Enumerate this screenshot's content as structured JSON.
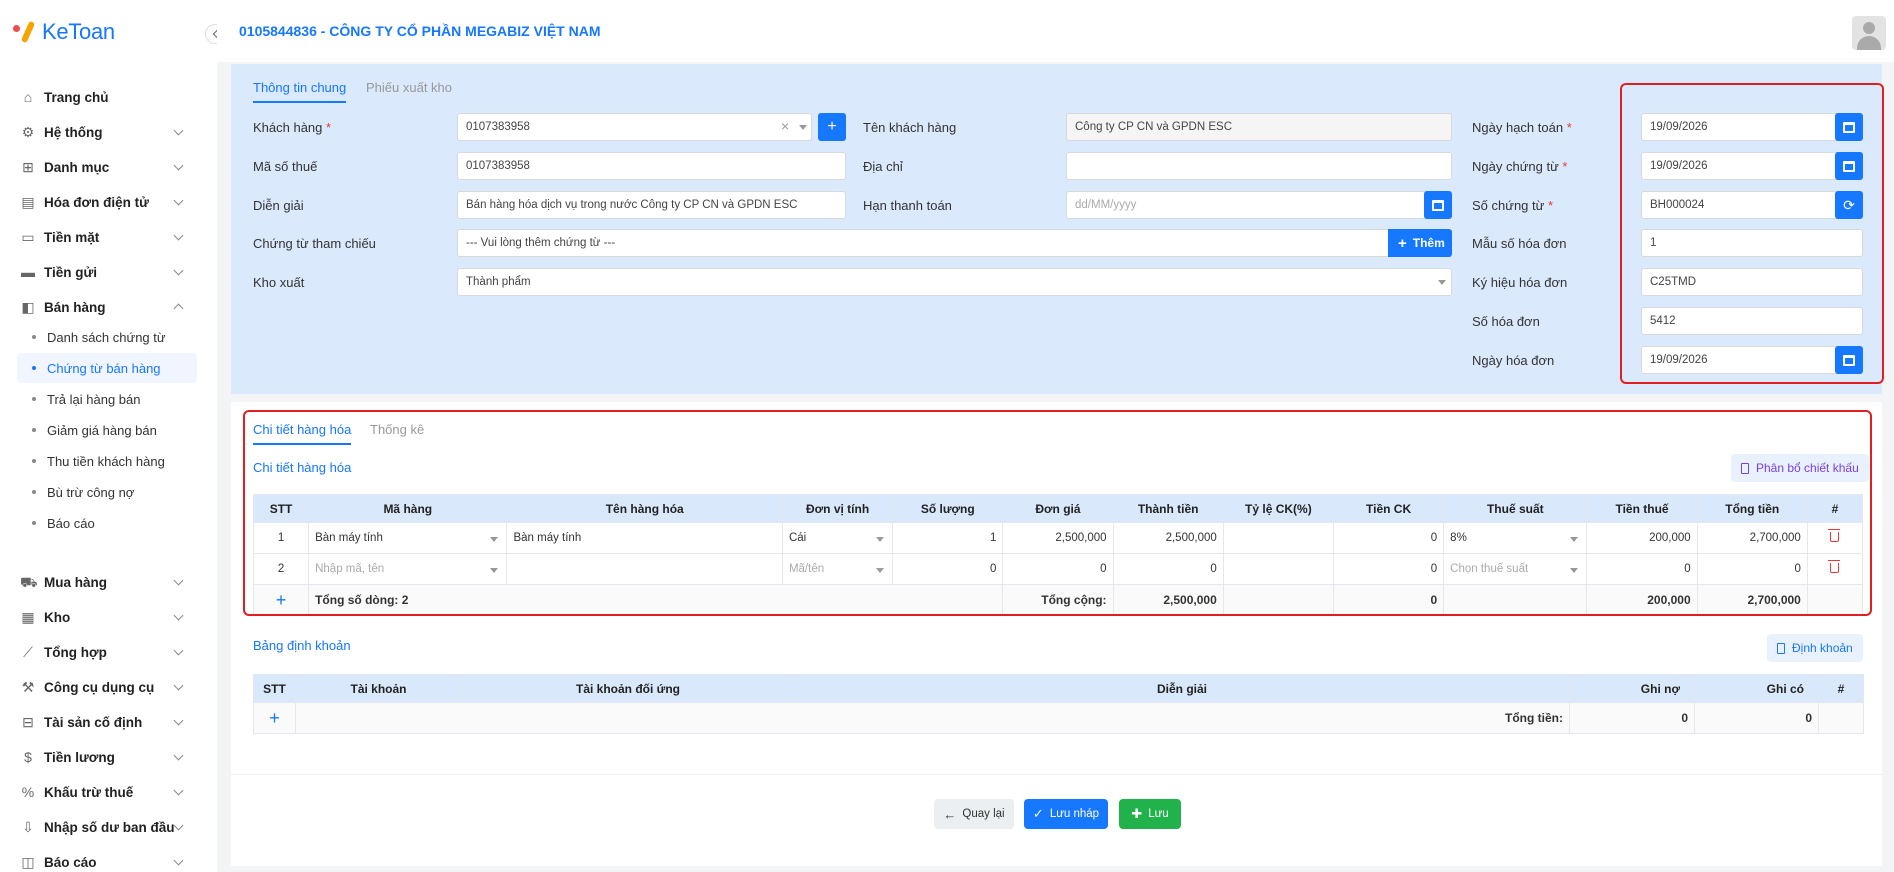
{
  "app": {
    "brand": "KeToan",
    "company": "0105844836 - CÔNG TY CỔ PHẦN MEGABIZ VIỆT NAM"
  },
  "sidebar": {
    "items": [
      {
        "label": "Trang chủ",
        "icon": "home-icon"
      },
      {
        "label": "Hệ thống",
        "icon": "gear-icon"
      },
      {
        "label": "Danh mục",
        "icon": "grid-icon"
      },
      {
        "label": "Hóa đơn điện tử",
        "icon": "invoice-icon"
      },
      {
        "label": "Tiền mặt",
        "icon": "cash-icon"
      },
      {
        "label": "Tiền gửi",
        "icon": "bank-card-icon"
      },
      {
        "label": "Bán hàng",
        "icon": "shopping-bag-icon"
      },
      {
        "label": "Mua hàng",
        "icon": "cart-icon"
      },
      {
        "label": "Kho",
        "icon": "warehouse-icon"
      },
      {
        "label": "Tổng hợp",
        "icon": "chart-line-icon"
      },
      {
        "label": "Công cụ dụng cụ",
        "icon": "tools-icon"
      },
      {
        "label": "Tài sản cố định",
        "icon": "car-icon"
      },
      {
        "label": "Tiền lương",
        "icon": "dollar-icon"
      },
      {
        "label": "Khấu trừ thuế",
        "icon": "tax-icon"
      },
      {
        "label": "Nhập số dư ban đầu",
        "icon": "import-icon"
      },
      {
        "label": "Báo cáo",
        "icon": "report-icon"
      }
    ],
    "sub_items": [
      "Danh sách chứng từ",
      "Chứng từ bán hàng",
      "Trả lại hàng bán",
      "Giảm giá hàng bán",
      "Thu tiền khách hàng",
      "Bù trừ công nợ",
      "Báo cáo"
    ]
  },
  "info": {
    "tabs": [
      "Thông tin chung",
      "Phiếu xuất kho"
    ],
    "labels": {
      "customer": "Khách hàng",
      "tax_code": "Mã số thuế",
      "description": "Diễn giải",
      "reference": "Chứng từ tham chiếu",
      "warehouse": "Kho xuất",
      "customer_name": "Tên khách hàng",
      "address": "Địa chỉ",
      "due_date": "Hạn thanh toán",
      "posting_date": "Ngày hạch toán",
      "voucher_date": "Ngày chứng từ",
      "voucher_no": "Số chứng từ",
      "invoice_template": "Mẫu số hóa đơn",
      "invoice_symbol": "Ký hiệu hóa đơn",
      "invoice_no": "Số hóa đơn",
      "invoice_date": "Ngày hóa đơn"
    },
    "values": {
      "customer": "0107383958",
      "tax_code": "0107383958",
      "description": "Bán hàng hóa dịch vụ trong nước Công ty CP CN và GPDN ESC",
      "reference_placeholder": "--- Vui lòng thêm chứng từ ---",
      "warehouse": "Thành phẩm",
      "customer_name": "Công ty CP CN và GPDN ESC",
      "address": "",
      "due_date_placeholder": "dd/MM/yyyy",
      "posting_date": "19/09/2026",
      "voucher_date": "19/09/2026",
      "voucher_no": "BH000024",
      "invoice_template": "1",
      "invoice_symbol": "C25TMD",
      "invoice_no": "5412",
      "invoice_date": "19/09/2026"
    },
    "add_button": "Thêm",
    "required_mark": "*"
  },
  "detail": {
    "tabs": [
      "Chi tiết hàng hóa",
      "Thống kê"
    ],
    "section_title": "Chi tiết hàng hóa",
    "allocate_button": "Phân bổ chiết khấu",
    "columns": [
      "STT",
      "Mã hàng",
      "Tên hàng hóa",
      "Đơn vị tính",
      "Số lượng",
      "Đơn giá",
      "Thành tiền",
      "Tỷ lệ CK(%)",
      "Tiền CK",
      "Thuế suất",
      "Tiền thuế",
      "Tổng tiền",
      "#"
    ],
    "rows": [
      {
        "stt": "1",
        "code": "Bàn máy tính",
        "name": "Bàn máy tính",
        "unit": "Cái",
        "qty": "1",
        "price": "2,500,000",
        "amount": "2,500,000",
        "disc_rate": "",
        "disc_amount": "0",
        "vat": "8%",
        "tax": "200,000",
        "total": "2,700,000"
      },
      {
        "stt": "2",
        "code": "Nhập mã, tên",
        "name": "",
        "unit": "Mã/tên",
        "qty": "0",
        "price": "0",
        "amount": "0",
        "disc_rate": "",
        "disc_amount": "0",
        "vat": "Chọn thuế suất",
        "tax": "0",
        "total": "0"
      }
    ],
    "footer": {
      "row_count": "Tổng số dòng: 2",
      "total_label": "Tổng cộng:",
      "amount": "2,500,000",
      "disc_amount": "0",
      "tax": "200,000",
      "total": "2,700,000"
    }
  },
  "accounting": {
    "title": "Bảng định khoản",
    "button": "Định khoản",
    "columns": [
      "STT",
      "Tài khoản",
      "Tài khoản đối ứng",
      "Diễn giải",
      "Ghi nợ",
      "Ghi có",
      "#"
    ],
    "total_label": "Tổng tiền:",
    "debit_total": "0",
    "credit_total": "0"
  },
  "actions": {
    "back": "Quay lại",
    "draft": "Lưu nháp",
    "save": "Lưu"
  },
  "colors": {
    "accent": "#1677ff",
    "panel": "#dbe9fc",
    "highlight": "#e02020",
    "save": "#22b24c"
  }
}
